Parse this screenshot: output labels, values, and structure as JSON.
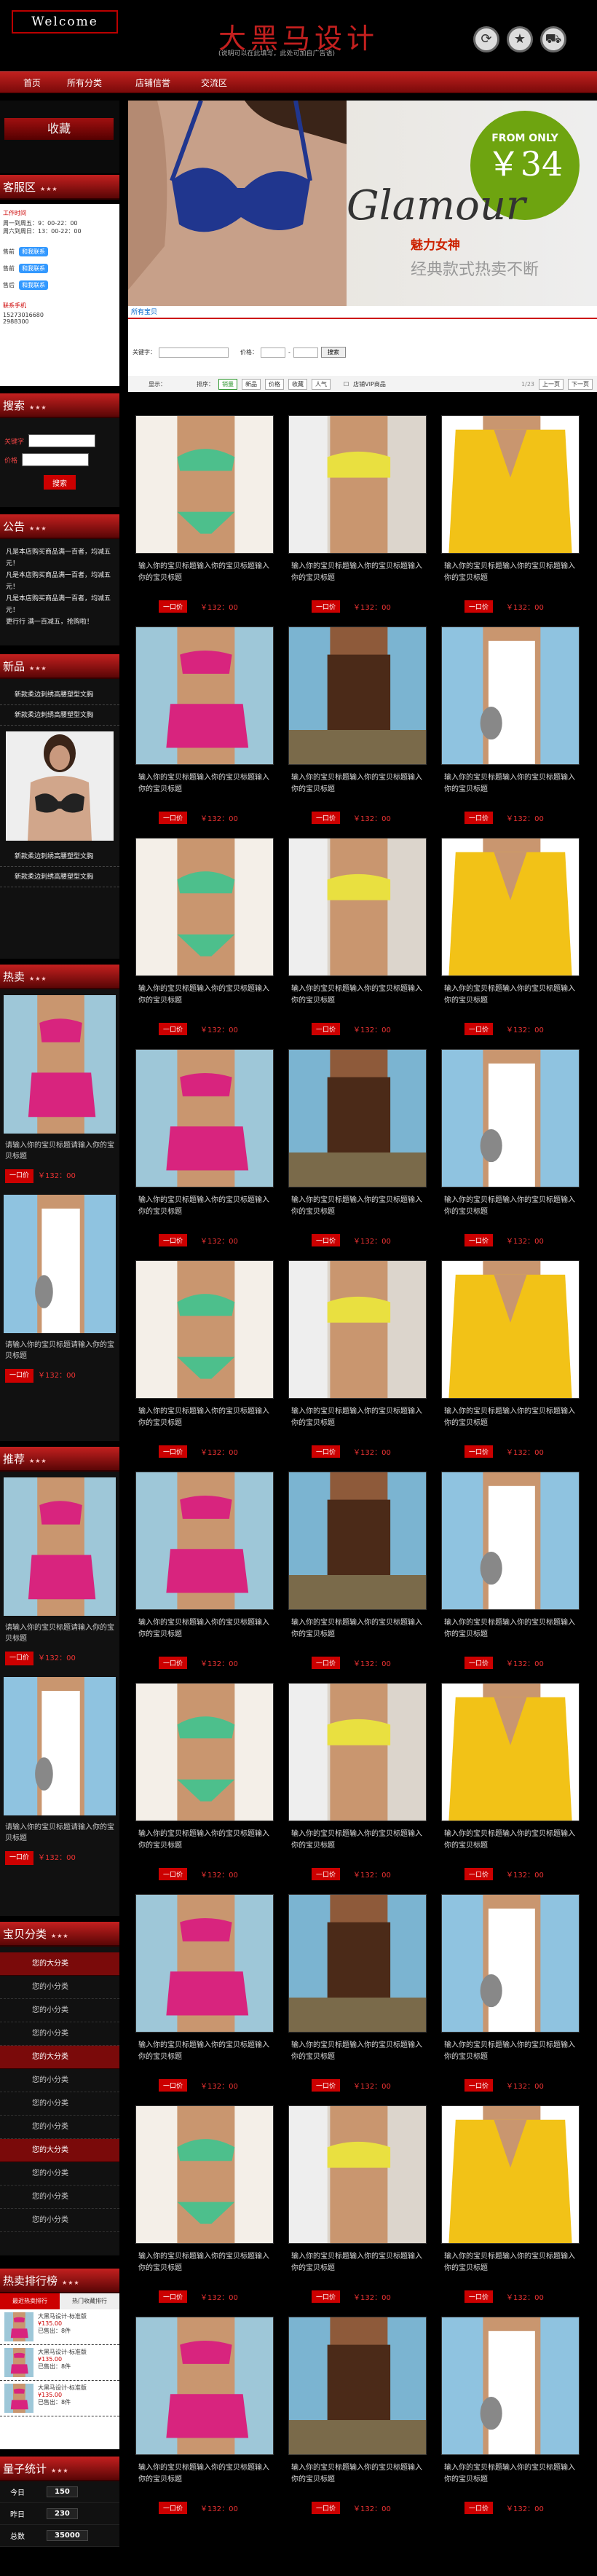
{
  "header": {
    "welcome": "Welcome",
    "title": "大黑马设计",
    "subtitle": "(说明可以在此填写，此处可加自广告语)",
    "icons": [
      "refresh-icon",
      "bookmark-icon",
      "cart-icon"
    ]
  },
  "nav": [
    "首页",
    "所有分类",
    "店铺信誉",
    "交流区"
  ],
  "sidebar": {
    "collect": "收藏",
    "service": {
      "title": "客服区",
      "tag": "★★★",
      "work_time_label": "工作时间",
      "weekdays": "周一到周五：9：00-22：00",
      "weekend": "周六到周日：13：00-22：00",
      "staff": [
        "售前",
        "售前",
        "售后"
      ],
      "qq_label": "和我联系",
      "phone_label": "联系手机",
      "phone": "15273016680",
      "tel": "2988300"
    },
    "search": {
      "title": "搜索",
      "tag": "★★★",
      "keyword_label": "关键字",
      "price_label": "价格",
      "button": "搜索"
    },
    "notice": {
      "title": "公告",
      "tag": "★★★",
      "lines": [
        "凡是本店购买商品满一百者，均减五元！",
        "凡是本店购买商品满一百者，均减五元！",
        "凡是本店购买商品满一百者，均减五元！",
        "更行行 满一百减五，抢购啦！"
      ]
    },
    "new": {
      "title": "新品",
      "tag": "★★★",
      "items": [
        "新款柔边刺绣高腰塑型文胸",
        "新款柔边刺绣高腰塑型文胸",
        "新款柔边刺绣高腰塑型文胸",
        "新款柔边刺绣高腰塑型文胸"
      ]
    },
    "hot": {
      "title": "热卖",
      "tag": "★★★",
      "items": [
        {
          "text": "请输入你的宝贝标题请输入你的宝贝标题",
          "buy": "一口价",
          "price": "￥132：00"
        },
        {
          "text": "请输入你的宝贝标题请输入你的宝贝标题",
          "buy": "一口价",
          "price": "￥132：00"
        }
      ]
    },
    "recommend": {
      "title": "推荐",
      "tag": "★★★",
      "items": [
        {
          "text": "请输入你的宝贝标题请输入你的宝贝标题",
          "buy": "一口价",
          "price": "￥132：00"
        },
        {
          "text": "请输入你的宝贝标题请输入你的宝贝标题",
          "buy": "一口价",
          "price": "￥132：00"
        }
      ]
    },
    "categories": {
      "title": "宝贝分类",
      "tag": "★★★",
      "groups": [
        {
          "main": "您的大分类",
          "subs": [
            "您的小分类",
            "您的小分类",
            "您的小分类"
          ]
        },
        {
          "main": "您的大分类",
          "subs": [
            "您的小分类",
            "您的小分类",
            "您的小分类"
          ]
        },
        {
          "main": "您的大分类",
          "subs": [
            "您的小分类",
            "您的小分类",
            "您的小分类"
          ]
        }
      ]
    },
    "ranking": {
      "title": "热卖排行榜",
      "tag": "★★★",
      "tabs": [
        "最近热卖排行",
        "热门收藏排行"
      ],
      "items": [
        {
          "text": "大黑马设计-标准版",
          "price": "¥135.00",
          "sold": "已售出：8件"
        },
        {
          "text": "大黑马设计-标准版",
          "price": "¥135.00",
          "sold": "已售出：8件"
        },
        {
          "text": "大黑马设计-标准版",
          "price": "¥135.00",
          "sold": "已售出：8件"
        }
      ]
    },
    "counter": {
      "title": "量子统计",
      "tag": "★★★",
      "rows": [
        {
          "label": "今日",
          "value": "150"
        },
        {
          "label": "昨日",
          "value": "230"
        },
        {
          "label": "总数",
          "value": "35000"
        }
      ]
    }
  },
  "banner": {
    "from_only": "FROM ONLY",
    "price": "￥34",
    "headline": "Glamour",
    "sub1": "魅力女神",
    "sub2": "经典款式热卖不断"
  },
  "products_header": {
    "all": "所有宝贝",
    "keyword_label": "关键字：",
    "price_label": "价格：",
    "button": "搜索",
    "show": "显示：",
    "sort": "排序：",
    "sort_opts": [
      "销量",
      "新品",
      "价格",
      "收藏",
      "人气"
    ],
    "check": "店铺VIP商品",
    "page": "1/23",
    "prev": "上一页",
    "next": "下一页"
  },
  "products": [
    {
      "text": "输入你的宝贝标题输入你的宝贝标题输入你的宝贝标题",
      "buy": "一口价",
      "price": "￥132：00",
      "img": "green"
    },
    {
      "text": "输入你的宝贝标题输入你的宝贝标题输入你的宝贝标题",
      "buy": "一口价",
      "price": "￥132：00",
      "img": "yellowbra"
    },
    {
      "text": "输入你的宝贝标题输入你的宝贝标题输入你的宝贝标题",
      "buy": "一口价",
      "price": "￥132：00",
      "img": "yellowtop"
    },
    {
      "text": "输入你的宝贝标题输入你的宝贝标题输入你的宝贝标题",
      "buy": "一口价",
      "price": "￥132：00",
      "img": "pink"
    },
    {
      "text": "输入你的宝贝标题输入你的宝贝标题输入你的宝贝标题",
      "buy": "一口价",
      "price": "￥132：00",
      "img": "brown"
    },
    {
      "text": "输入你的宝贝标题输入你的宝贝标题输入你的宝贝标题",
      "buy": "一口价",
      "price": "￥132：00",
      "img": "white"
    },
    {
      "text": "输入你的宝贝标题输入你的宝贝标题输入你的宝贝标题",
      "buy": "一口价",
      "price": "￥132：00",
      "img": "green"
    },
    {
      "text": "输入你的宝贝标题输入你的宝贝标题输入你的宝贝标题",
      "buy": "一口价",
      "price": "￥132：00",
      "img": "yellowbra"
    },
    {
      "text": "输入你的宝贝标题输入你的宝贝标题输入你的宝贝标题",
      "buy": "一口价",
      "price": "￥132：00",
      "img": "yellowtop"
    },
    {
      "text": "输入你的宝贝标题输入你的宝贝标题输入你的宝贝标题",
      "buy": "一口价",
      "price": "￥132：00",
      "img": "pink"
    },
    {
      "text": "输入你的宝贝标题输入你的宝贝标题输入你的宝贝标题",
      "buy": "一口价",
      "price": "￥132：00",
      "img": "brown"
    },
    {
      "text": "输入你的宝贝标题输入你的宝贝标题输入你的宝贝标题",
      "buy": "一口价",
      "price": "￥132：00",
      "img": "white"
    },
    {
      "text": "输入你的宝贝标题输入你的宝贝标题输入你的宝贝标题",
      "buy": "一口价",
      "price": "￥132：00",
      "img": "green"
    },
    {
      "text": "输入你的宝贝标题输入你的宝贝标题输入你的宝贝标题",
      "buy": "一口价",
      "price": "￥132：00",
      "img": "yellowbra"
    },
    {
      "text": "输入你的宝贝标题输入你的宝贝标题输入你的宝贝标题",
      "buy": "一口价",
      "price": "￥132：00",
      "img": "yellowtop"
    },
    {
      "text": "输入你的宝贝标题输入你的宝贝标题输入你的宝贝标题",
      "buy": "一口价",
      "price": "￥132：00",
      "img": "pink"
    },
    {
      "text": "输入你的宝贝标题输入你的宝贝标题输入你的宝贝标题",
      "buy": "一口价",
      "price": "￥132：00",
      "img": "brown"
    },
    {
      "text": "输入你的宝贝标题输入你的宝贝标题输入你的宝贝标题",
      "buy": "一口价",
      "price": "￥132：00",
      "img": "white"
    },
    {
      "text": "输入你的宝贝标题输入你的宝贝标题输入你的宝贝标题",
      "buy": "一口价",
      "price": "￥132：00",
      "img": "green"
    },
    {
      "text": "输入你的宝贝标题输入你的宝贝标题输入你的宝贝标题",
      "buy": "一口价",
      "price": "￥132：00",
      "img": "yellowbra"
    },
    {
      "text": "输入你的宝贝标题输入你的宝贝标题输入你的宝贝标题",
      "buy": "一口价",
      "price": "￥132：00",
      "img": "yellowtop"
    },
    {
      "text": "输入你的宝贝标题输入你的宝贝标题输入你的宝贝标题",
      "buy": "一口价",
      "price": "￥132：00",
      "img": "pink"
    },
    {
      "text": "输入你的宝贝标题输入你的宝贝标题输入你的宝贝标题",
      "buy": "一口价",
      "price": "￥132：00",
      "img": "brown"
    },
    {
      "text": "输入你的宝贝标题输入你的宝贝标题输入你的宝贝标题",
      "buy": "一口价",
      "price": "￥132：00",
      "img": "white"
    },
    {
      "text": "输入你的宝贝标题输入你的宝贝标题输入你的宝贝标题",
      "buy": "一口价",
      "price": "￥132：00",
      "img": "green"
    },
    {
      "text": "输入你的宝贝标题输入你的宝贝标题输入你的宝贝标题",
      "buy": "一口价",
      "price": "￥132：00",
      "img": "yellowbra"
    },
    {
      "text": "输入你的宝贝标题输入你的宝贝标题输入你的宝贝标题",
      "buy": "一口价",
      "price": "￥132：00",
      "img": "yellowtop"
    },
    {
      "text": "输入你的宝贝标题输入你的宝贝标题输入你的宝贝标题",
      "buy": "一口价",
      "price": "￥132：00",
      "img": "pink"
    },
    {
      "text": "输入你的宝贝标题输入你的宝贝标题输入你的宝贝标题",
      "buy": "一口价",
      "price": "￥132：00",
      "img": "brown"
    },
    {
      "text": "输入你的宝贝标题输入你的宝贝标题输入你的宝贝标题",
      "buy": "一口价",
      "price": "￥132：00",
      "img": "white"
    }
  ],
  "colors": {
    "accent": "#c4201f",
    "banner_badge": "#6ea410"
  }
}
